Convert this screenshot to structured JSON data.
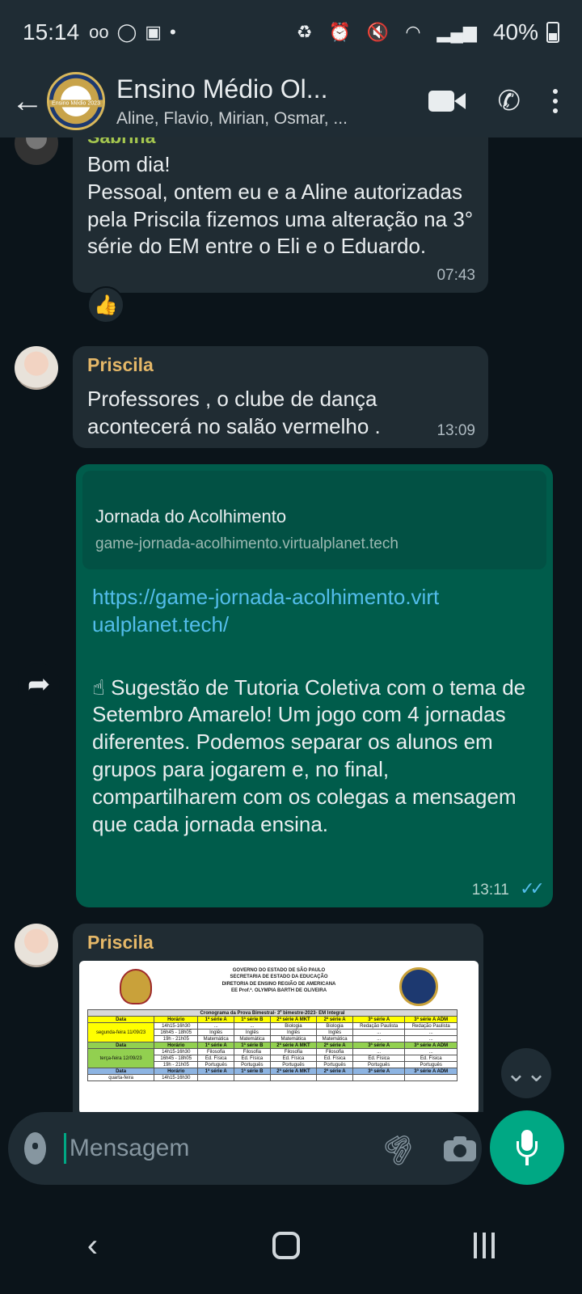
{
  "status_bar": {
    "time": "15:14",
    "battery": "40%",
    "left_icons": [
      "voicemail-icon",
      "whatsapp-icon",
      "gallery-icon",
      "dot-icon"
    ],
    "right_icons": [
      "battery-saver-icon",
      "alarm-icon",
      "mute-icon",
      "wifi-icon",
      "signal-icon",
      "signal-icon"
    ]
  },
  "header": {
    "back": "←",
    "group_name": "Ensino Médio Ol...",
    "members": "Aline, Flavio, Mirian, Osmar, ...",
    "avatar_badge": "Ensino Médio 2023",
    "phone": "✆"
  },
  "messages": [
    {
      "sender": "Sabrina",
      "text_lines": [
        "Bom dia!",
        "Pessoal, ontem eu e a Aline autorizadas pela Priscila fizemos uma alteração na 3° série do EM entre o Eli e o Eduardo."
      ],
      "time": "07:43",
      "reaction": "👍"
    },
    {
      "sender": "Priscila",
      "text": "Professores , o clube de dança acontecerá no salão vermelho .",
      "time": "13:09"
    },
    {
      "link_title": "Jornada do Acolhimento",
      "link_domain": "game-jornada-acolhimento.virtualplanet.tech",
      "url": "https://game-jornada-acolhimento.virtualplanet.tech/",
      "emoji": "☝",
      "text": "Sugestão de Tutoria Coletiva com o tema de Setembro Amarelo! Um jogo com 4 jornadas diferentes. Podemos separar os alunos em grupos para jogarem e, no final, compartilharem com os colegas a mensagem que cada jornada ensina.",
      "time": "13:11",
      "ticks": "✓✓",
      "forward": "➦"
    },
    {
      "sender": "Priscila",
      "document": {
        "header_lines": [
          "GOVERNO DO ESTADO DE SÃO PAULO",
          "SECRETARIA DE ESTADO DA EDUCAÇÃO",
          "DIRETORIA DE ENSINO REGIÃO DE AMERICANA",
          "EE Prof.ª. OLYMPIA BARTH DE OLIVEIRA"
        ],
        "table_title": "Cronograma da Prova Bimestral- 3º bimestre-2023- EM Integral",
        "header_row": [
          "Data",
          "Horário",
          "1ª série A",
          "1ª série B",
          "2ª série A MKT",
          "2ª série A",
          "3ª série A",
          "3ª série A ADM"
        ],
        "rows": [
          [
            "segunda-feira 11/09/23",
            "14h15-16h30",
            "...",
            "...",
            "Biologia",
            "Biologia",
            "Redação Paulista",
            "Redação Paulista"
          ],
          [
            "",
            "16h45 - 18h05",
            "Inglês",
            "Inglês",
            "Inglês",
            "Inglês",
            "...",
            "..."
          ],
          [
            "",
            "19h - 21h05",
            "Matemática",
            "Matemática",
            "Matemática",
            "Matemática",
            "...",
            "..."
          ],
          [
            "terça-feira 12/09/23",
            "14h15-16h30",
            "Filosofia",
            "Filosofia",
            "Filosofia",
            "Filosofia",
            "...",
            "..."
          ],
          [
            "",
            "16h45 - 18h05",
            "Ed. Física",
            "Ed. Física",
            "Ed. Física",
            "Ed. Física",
            "Ed. Física",
            "Ed. Física"
          ],
          [
            "",
            "19h - 21h05",
            "Português",
            "Português",
            "Português",
            "Português",
            "Português",
            "Português"
          ],
          [
            "quarta-feira",
            "14h15-16h30",
            "",
            "",
            "",
            "",
            "",
            ""
          ]
        ]
      }
    }
  ],
  "scroll_down": "⌄⌄",
  "input": {
    "placeholder": "Mensagem",
    "clip": "🖇"
  },
  "nav": {
    "back": "‹"
  },
  "colors": {
    "header_bg": "#1f2c34",
    "chat_bg": "#0b141a",
    "incoming_bubble": "#202c33",
    "outgoing_bubble": "#005c4b",
    "accent_green": "#00a884",
    "link_blue": "#53bdeb",
    "sender_name": "#e4b768"
  }
}
